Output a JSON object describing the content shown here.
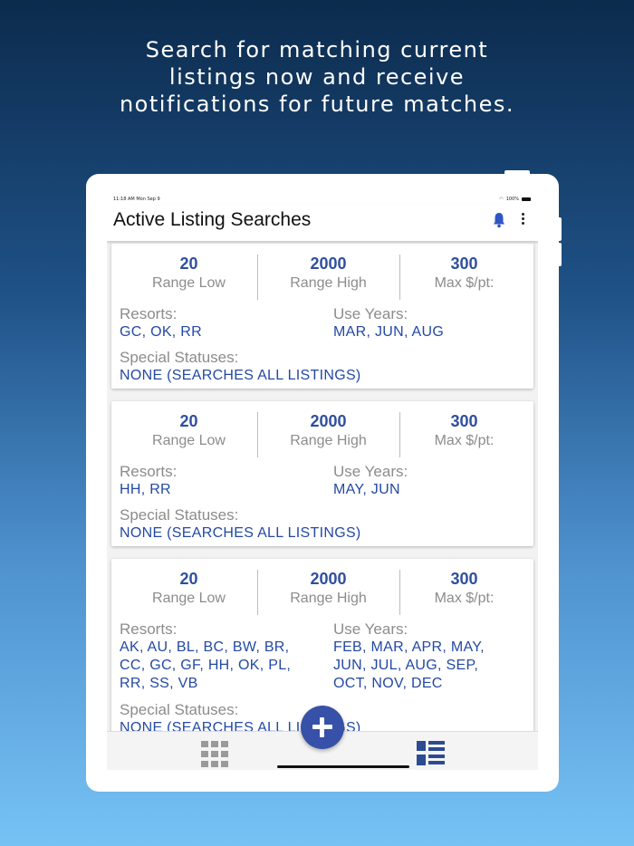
{
  "headline": {
    "line1": "Search for matching current",
    "line2": "listings now and receive",
    "line3": "notifications for future matches."
  },
  "statusbar": {
    "time_date": "11:18 AM  Mon Sep 9",
    "battery": "100%"
  },
  "appbar": {
    "title": "Active Listing Searches",
    "bell_icon": "bell-icon",
    "menu_icon": "more-vertical-icon"
  },
  "labels": {
    "range_low": "Range Low",
    "range_high": "Range High",
    "max_price": "Max $/pt:",
    "resorts": "Resorts:",
    "use_years": "Use Years:",
    "special_statuses": "Special Statuses:"
  },
  "searches": [
    {
      "range_low": "20",
      "range_high": "2000",
      "max_price": "300",
      "resorts": [
        "GC, OK, RR"
      ],
      "use_years": [
        "MAR, JUN, AUG"
      ],
      "special_statuses": "NONE (SEARCHES ALL LISTINGS)"
    },
    {
      "range_low": "20",
      "range_high": "2000",
      "max_price": "300",
      "resorts": [
        "HH, RR"
      ],
      "use_years": [
        "MAY, JUN"
      ],
      "special_statuses": "NONE (SEARCHES ALL LISTINGS)"
    },
    {
      "range_low": "20",
      "range_high": "2000",
      "max_price": "300",
      "resorts": [
        "AK, AU, BL, BC, BW, BR,",
        "CC, GC, GF, HH, OK, PL,",
        "RR, SS, VB"
      ],
      "use_years": [
        "FEB, MAR, APR, MAY,",
        "JUN, JUL, AUG, SEP,",
        "OCT, NOV, DEC"
      ],
      "special_statuses": "NONE (SEARCHES ALL LISTINGS)"
    }
  ],
  "bottom_nav": {
    "grid_icon": "grid-icon",
    "list_icon": "list-view-icon",
    "fab_icon": "plus-icon"
  },
  "colors": {
    "accent": "#2f4f9e",
    "fab": "#3751a8",
    "label_gray": "#8c8c8c",
    "value_blue": "#2349a3"
  }
}
